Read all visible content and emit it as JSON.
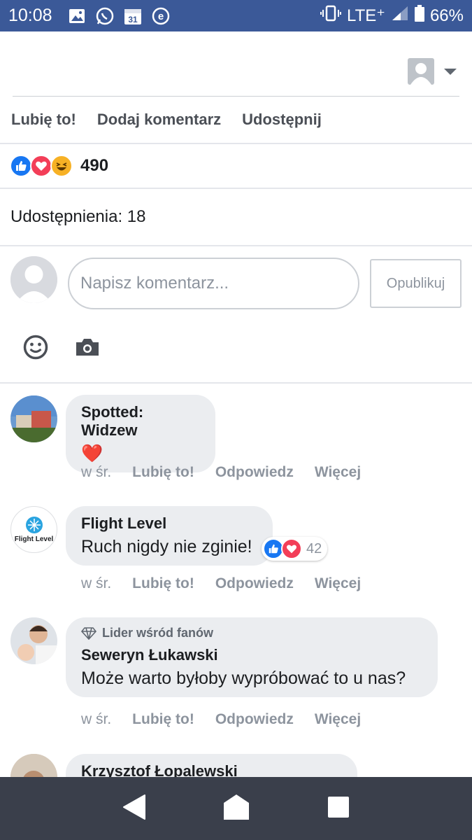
{
  "status_bar": {
    "time": "10:08",
    "network": "LTE⁺",
    "battery": "66%",
    "icons": [
      "image-icon",
      "whatsapp-icon",
      "calendar-icon",
      "e-icon",
      "vibrate-icon",
      "signal-icon",
      "battery-icon"
    ],
    "calendar_day": "31",
    "e_letter": "e"
  },
  "actions": {
    "like": "Lubię to!",
    "comment": "Dodaj komentarz",
    "share": "Udostępnij"
  },
  "reactions": {
    "count": "490",
    "types": [
      "like",
      "love",
      "haha"
    ]
  },
  "shares": {
    "text": "Udostępnienia: 18"
  },
  "composer": {
    "placeholder": "Napisz komentarz...",
    "post_label": "Opublikuj"
  },
  "comments": [
    {
      "author": "Spotted: Widzew",
      "text": "❤️",
      "time": "w śr.",
      "like": "Lubię to!",
      "reply": "Odpowiedz",
      "more": "Więcej"
    },
    {
      "author": "Flight Level",
      "avatar_text": "Flight Level",
      "text": "Ruch nigdy nie zginie!",
      "reactions": "42",
      "time": "w śr.",
      "like": "Lubię to!",
      "reply": "Odpowiedz",
      "more": "Więcej"
    },
    {
      "badge": "Lider wśród fanów",
      "author": "Seweryn Łukawski",
      "text": "Może warto byłoby wypróbować to u nas?",
      "time": "w śr.",
      "like": "Lubię to!",
      "reply": "Odpowiedz",
      "more": "Więcej"
    },
    {
      "author": "Krzysztof Łopalewski"
    }
  ],
  "colors": {
    "brand": "#3b5998",
    "like": "#1877f2",
    "love": "#f33e58",
    "haha": "#f7b125",
    "nav": "#3a3f4b"
  }
}
